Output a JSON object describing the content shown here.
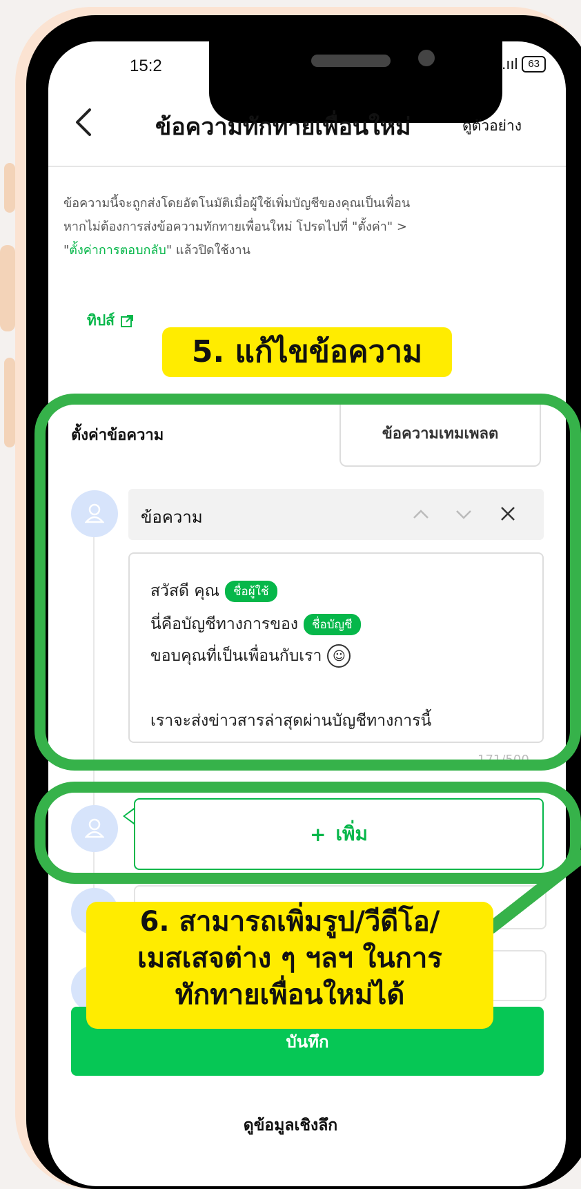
{
  "status_bar": {
    "time": "15:2",
    "signal": "ıl .ııl",
    "battery": "63"
  },
  "header": {
    "title": "ข้อความทักทายเพื่อนใหม่",
    "preview": "ดูตัวอย่าง"
  },
  "description": {
    "line1": "ข้อความนี้จะถูกส่งโดยอัตโนมัติเมื่อผู้ใช้เพิ่มบัญชีของคุณเป็นเพื่อน",
    "line2": "หากไม่ต้องการส่งข้อความทักทายเพื่อนใหม่ โปรดไปที่ \"ตั้งค่า\" >",
    "line3_quote_open": "\"",
    "line3_green": "ตั้งค่าการตอบกลับ",
    "line3_rest": "\" แล้วปิดใช้งาน"
  },
  "tips": {
    "label": "ทิปส์"
  },
  "callouts": {
    "step5": "5. แก้ไขข้อความ",
    "step6_line1": "6. สามารถเพิ่มรูป/วีดีโอ/",
    "step6_line2": "เมสเสจต่าง ๆ ฯลฯ ในการ",
    "step6_line3": "ทักทายเพื่อนใหม่ได้"
  },
  "settings": {
    "section_label": "ตั้งค่าข้อความ",
    "template_button": "ข้อความเทมเพลต"
  },
  "message": {
    "type_label": "ข้อความ",
    "line1_text": "สวัสดี คุณ",
    "line1_chip": "ชื่อผู้ใช้",
    "line2_text": "นี่คือบัญชีทางการของ",
    "line2_chip": "ชื่อบัญชี",
    "line3_text": "ขอบคุณที่เป็นเพื่อนกับเรา",
    "line4_text": "เราจะส่งข่าวสารล่าสุดผ่านบัญชีทางการนี้",
    "counter": "171/500"
  },
  "add_button": {
    "icon": "+",
    "label": "เพิ่ม"
  },
  "save_button": {
    "label": "บันทึก"
  },
  "insight_link": {
    "label": "ดูข้อมูลเชิงลึก"
  },
  "colors": {
    "line_green": "#06c755",
    "highlight_green": "#36b24a",
    "callout_yellow": "#ffec00"
  }
}
